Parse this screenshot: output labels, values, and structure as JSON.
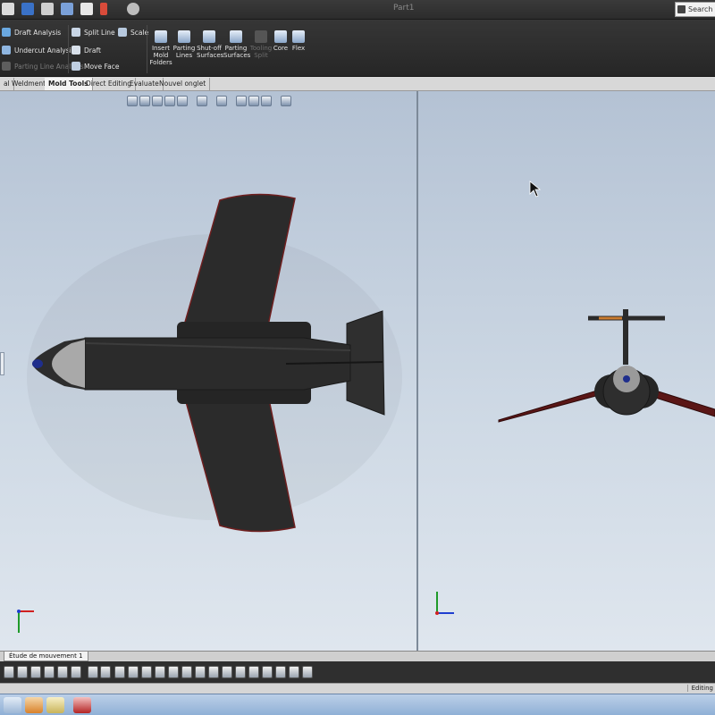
{
  "window": {
    "title": "Part1",
    "search_label": "Search Co"
  },
  "quick_access": {
    "icons": [
      "new-document-icon",
      "save-icon",
      "print-icon",
      "undo-icon",
      "select-arrow-icon",
      "rebuild-icon",
      "options-gear-icon"
    ]
  },
  "ribbon": {
    "analysis": {
      "draft_analysis": "Draft Analysis",
      "undercut_analysis": "Undercut Analysis",
      "parting_line_analysis": "Parting Line Analysis"
    },
    "tools": {
      "split_line": "Split Line",
      "scale": "Scale",
      "draft": "Draft",
      "move_face": "Move Face"
    },
    "buttons": {
      "insert_mold_folders": "Insert\nMold\nFolders",
      "parting_lines": "Parting\nLines",
      "shutoff_surfaces": "Shut-off\nSurfaces",
      "parting_surfaces": "Parting\nSurfaces",
      "tooling_split": "Tooling\nSplit",
      "core": "Core",
      "flex": "Flex"
    }
  },
  "tabs": [
    {
      "label": "al",
      "active": false
    },
    {
      "label": "Weldments",
      "active": false
    },
    {
      "label": "Mold Tools",
      "active": true
    },
    {
      "label": "Direct Editing",
      "active": false
    },
    {
      "label": "Evaluate",
      "active": false
    },
    {
      "label": "Nouvel onglet",
      "active": false
    }
  ],
  "bottom": {
    "motion_study_tab": "Étude de mouvement 1",
    "status": "Editing"
  },
  "colors": {
    "fuselage": "#2b2b2b",
    "wing_edge": "#6e1f1f",
    "nose_cone": "#a9a9a9",
    "nose_tip": "#1f2e8c",
    "wing_accent": "#5a1616",
    "tail_stripe": "#c97a2e",
    "axis_x": "#d02020",
    "axis_y": "#1f9a2a",
    "axis_z": "#1f3ed0"
  },
  "taskbar": {
    "icons": [
      "windows-explorer-icon",
      "solidworks-icon",
      "file-manager-icon",
      "pdf-icon"
    ]
  }
}
